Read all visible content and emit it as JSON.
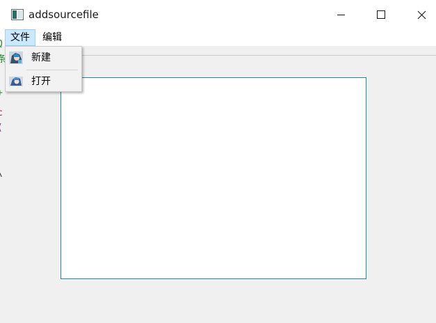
{
  "window": {
    "title": "addsourcefile"
  },
  "menubar": {
    "file_label": "文件",
    "edit_label": "编辑"
  },
  "file_menu": {
    "new_label": "新建",
    "open_label": "打开"
  },
  "background_text": {
    "fragments": [
      "Q",
      "条",
      "+",
      "c",
      "(",
      "(",
      "\\"
    ]
  },
  "colors": {
    "menu_highlight": "#cce8ff",
    "canvas_border": "#1c8a96",
    "window_bg": "#f0f0f0"
  }
}
